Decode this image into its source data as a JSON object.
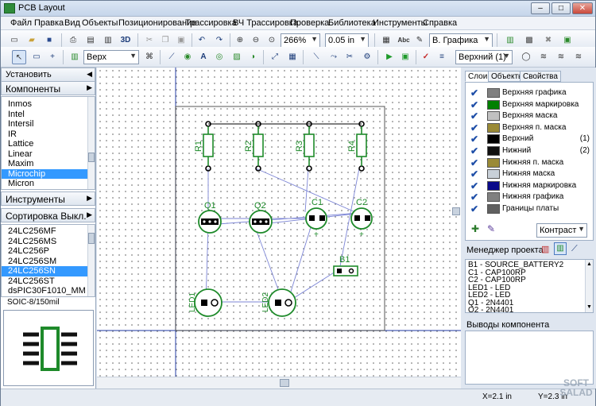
{
  "window": {
    "title": "PCB Layout",
    "minimize": "–",
    "maximize": "□",
    "close": "✕"
  },
  "menu": [
    "Файл",
    "Правка",
    "Вид",
    "Объекты",
    "Позиционирование",
    "Трассировка",
    "ВЧ Трассировка",
    "Проверка",
    "Библиотека",
    "Инструменты",
    "Справка"
  ],
  "toolbar1": {
    "zoom": "266%",
    "grid": "0.05 in",
    "layer": "В. Графика",
    "btn_3d": "3D"
  },
  "toolbar2": {
    "side": "Верх",
    "active_layer": "Верхний (1)"
  },
  "left": {
    "install_label": "Установить компонент",
    "components_label": "Компоненты",
    "vendors": [
      "Inmos",
      "Intel",
      "Intersil",
      "IR",
      "Lattice",
      "Linear",
      "Maxim",
      "Microchip",
      "Micron"
    ],
    "vendor_selected": "Microchip",
    "tools_label": "Инструменты",
    "sort_label": "Сортировка Выкл.",
    "parts": [
      "24LC256MF",
      "24LC256MS",
      "24LC256P",
      "24LC256SM",
      "24LC256SN",
      "24LC256ST",
      "dsPIC30F1010_MM"
    ],
    "part_selected": "24LC256SN",
    "package": "SOIC-8/150mil"
  },
  "canvas": {
    "labels": {
      "r1": "R1",
      "r2": "R2",
      "r3": "R3",
      "r4": "R4",
      "q1": "Q1",
      "q2": "Q2",
      "c1": "C1",
      "c2": "C2",
      "b1": "B1",
      "led1": "LED1",
      "led2": "LED2"
    },
    "plus": "+"
  },
  "right": {
    "tabs": [
      "Слои",
      "Объекты",
      "Свойства"
    ],
    "layers": [
      {
        "name": "Верхняя графика",
        "color": "#808080",
        "num": ""
      },
      {
        "name": "Верхняя маркировка",
        "color": "#008000",
        "num": ""
      },
      {
        "name": "Верхняя маска",
        "color": "#c0c0c0",
        "num": ""
      },
      {
        "name": "Верхняя п. маска",
        "color": "#9a8a36",
        "num": ""
      },
      {
        "name": "Верхний",
        "color": "#000000",
        "num": "(1)"
      },
      {
        "name": "Нижний",
        "color": "#101010",
        "num": "(2)"
      },
      {
        "name": "Нижняя п. маска",
        "color": "#9a8a36",
        "num": ""
      },
      {
        "name": "Нижняя маска",
        "color": "#c8d0d8",
        "num": ""
      },
      {
        "name": "Нижняя маркировка",
        "color": "#0a0a8a",
        "num": ""
      },
      {
        "name": "Нижняя графика",
        "color": "#808080",
        "num": ""
      },
      {
        "name": "Границы платы",
        "color": "#606060",
        "num": ""
      }
    ],
    "contrast": "Контраст",
    "project_manager": "Менеджер проекта",
    "project_items": [
      "B1 - SOURCE_BATTERY2",
      "C1 - CAP100RP",
      "C2 - CAP100RP",
      "LED1 - LED",
      "LED2 - LED",
      "Q1 - 2N4401",
      "Q2 - 2N4401"
    ],
    "pins_label": "Выводы компонента"
  },
  "status": {
    "x": "X=2.1 in",
    "y": "Y=2.3 in"
  },
  "watermark": "SOFT SALAD"
}
